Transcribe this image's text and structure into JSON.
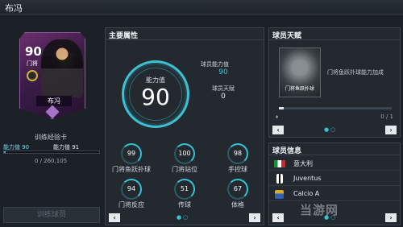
{
  "header": {
    "title": "布冯"
  },
  "card": {
    "rating": "90",
    "position": "门将",
    "name": "布冯"
  },
  "left": {
    "card_type": "训练经验卡",
    "xp_current_label": "能力值 90",
    "xp_next_label": "能力值 91",
    "xp_progress_text": "0 / 260,105",
    "xp_progress_fraction": 0,
    "train_button": "训练球员"
  },
  "main": {
    "title": "主要属性",
    "ability_label": "能力值",
    "ability_value": "90",
    "player_ability_label": "球员能力值",
    "player_ability_value": "90",
    "talent_label": "球员天赋",
    "talent_value": "0",
    "stats": [
      {
        "value": "99",
        "label": "门将鱼跃扑球"
      },
      {
        "value": "100",
        "label": "门将站位"
      },
      {
        "value": "98",
        "label": "手控球"
      },
      {
        "value": "94",
        "label": "门将反应"
      },
      {
        "value": "51",
        "label": "传球"
      },
      {
        "value": "67",
        "label": "体格"
      }
    ],
    "prev": "‹",
    "next": "›",
    "dots": "●○"
  },
  "talent": {
    "title": "球员天赋",
    "card_name": "门将鱼跃扑球",
    "description": "门将鱼跃扑球能力加成",
    "count": "0 / 1",
    "prev": "‹",
    "next": "›",
    "dots": "●○"
  },
  "info": {
    "title": "球员信息",
    "rows": [
      {
        "text": "意大利",
        "icon": "italy-flag-icon"
      },
      {
        "text": "Juventus",
        "icon": "juventus-icon"
      },
      {
        "text": "Calcio A",
        "icon": "calcio-a-icon"
      }
    ],
    "prev": "‹",
    "next": "›",
    "dots": "●○"
  },
  "watermark": "当游网"
}
